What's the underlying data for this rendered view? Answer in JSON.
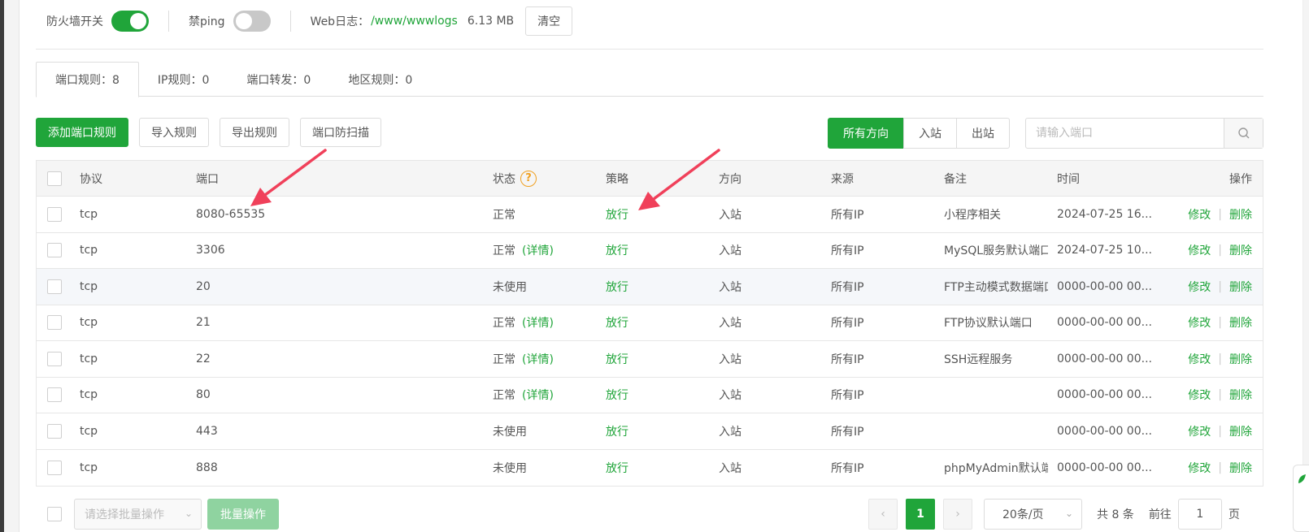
{
  "top": {
    "firewall_label": "防火墙开关",
    "firewall_on": true,
    "ping_label": "禁ping",
    "ping_on": false,
    "log_label": "Web日志：",
    "log_path": "/www/wwwlogs",
    "log_size": "6.13 MB",
    "clear_button": "清空"
  },
  "tabs": [
    {
      "label": "端口规则：8",
      "active": true
    },
    {
      "label": "IP规则：0",
      "active": false
    },
    {
      "label": "端口转发：0",
      "active": false
    },
    {
      "label": "地区规则：0",
      "active": false
    }
  ],
  "toolbar": {
    "add_rule": "添加端口规则",
    "import_rule": "导入规则",
    "export_rule": "导出规则",
    "anti_scan": "端口防扫描",
    "direction_all": "所有方向",
    "direction_in": "入站",
    "direction_out": "出站",
    "search_placeholder": "请输入端口"
  },
  "table": {
    "headers": {
      "protocol": "协议",
      "port": "端口",
      "status": "状态",
      "status_help": "?",
      "policy": "策略",
      "direction": "方向",
      "source": "来源",
      "note": "备注",
      "time": "时间",
      "action": "操作"
    },
    "edit_label": "修改",
    "delete_label": "删除",
    "separator": "|",
    "rows": [
      {
        "protocol": "tcp",
        "port": "8080-65535",
        "status": "正常",
        "detail": "",
        "policy": "放行",
        "direction": "入站",
        "source": "所有IP",
        "note": "小程序相关",
        "time": "2024-07-25 16..."
      },
      {
        "protocol": "tcp",
        "port": "3306",
        "status": "正常",
        "detail": "(详情)",
        "policy": "放行",
        "direction": "入站",
        "source": "所有IP",
        "note": "MySQL服务默认端口",
        "time": "2024-07-25 10..."
      },
      {
        "protocol": "tcp",
        "port": "20",
        "status": "未使用",
        "detail": "",
        "policy": "放行",
        "direction": "入站",
        "source": "所有IP",
        "note": "FTP主动模式数据端口",
        "time": "0000-00-00 00..."
      },
      {
        "protocol": "tcp",
        "port": "21",
        "status": "正常",
        "detail": "(详情)",
        "policy": "放行",
        "direction": "入站",
        "source": "所有IP",
        "note": "FTP协议默认端口",
        "time": "0000-00-00 00..."
      },
      {
        "protocol": "tcp",
        "port": "22",
        "status": "正常",
        "detail": "(详情)",
        "policy": "放行",
        "direction": "入站",
        "source": "所有IP",
        "note": "SSH远程服务",
        "time": "0000-00-00 00..."
      },
      {
        "protocol": "tcp",
        "port": "80",
        "status": "正常",
        "detail": "(详情)",
        "policy": "放行",
        "direction": "入站",
        "source": "所有IP",
        "note": "",
        "time": "0000-00-00 00..."
      },
      {
        "protocol": "tcp",
        "port": "443",
        "status": "未使用",
        "detail": "",
        "policy": "放行",
        "direction": "入站",
        "source": "所有IP",
        "note": "",
        "time": "0000-00-00 00..."
      },
      {
        "protocol": "tcp",
        "port": "888",
        "status": "未使用",
        "detail": "",
        "policy": "放行",
        "direction": "入站",
        "source": "所有IP",
        "note": "phpMyAdmin默认端口",
        "time": "0000-00-00 00..."
      }
    ]
  },
  "footer": {
    "batch_select_placeholder": "请选择批量操作",
    "batch_button": "批量操作",
    "prev": "‹",
    "current_page": "1",
    "next": "›",
    "page_size": "20条/页",
    "total": "共 8 条",
    "goto_label": "前往",
    "goto_value": "1",
    "goto_unit": "页"
  },
  "colors": {
    "accent": "#20a53a",
    "annotation_arrow": "#f0405a",
    "help_icon": "#f0a020"
  }
}
